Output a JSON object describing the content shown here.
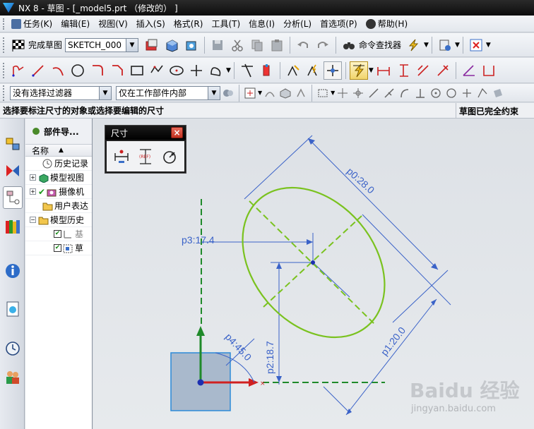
{
  "window": {
    "title": "NX 8 - 草图 - [_model5.prt （修改的） ]"
  },
  "menu": {
    "items": [
      "任务(K)",
      "编辑(E)",
      "视图(V)",
      "插入(S)",
      "格式(R)",
      "工具(T)",
      "信息(I)",
      "分析(L)",
      "首选项(P)",
      "帮助(H)"
    ]
  },
  "toolbar": {
    "finish_sketch": "完成草图",
    "sketch_name": "SKETCH_000",
    "command_finder": "命令查找器"
  },
  "filters": {
    "selection_filter": "没有选择过滤器",
    "scope": "仅在工作部件内部"
  },
  "status": {
    "prompt": "选择要标注尺寸的对象或选择要编辑的尺寸",
    "constraint_state": "草图已完全约束"
  },
  "navigator": {
    "title": "部件导...",
    "column_name": "名称",
    "rows": [
      {
        "label": "历史记录",
        "icon": "history-clock-icon"
      },
      {
        "label": "模型视图",
        "icon": "model-views-icon"
      },
      {
        "label": "摄像机",
        "icon": "camera-icon"
      },
      {
        "label": "用户表达",
        "icon": "folder-icon"
      },
      {
        "label": "模型历史",
        "icon": "folder-icon"
      },
      {
        "label": "基",
        "icon": "datum-icon"
      },
      {
        "label": "草",
        "icon": "sketch-icon"
      }
    ]
  },
  "dimension_dialog": {
    "title": "尺寸",
    "tools": [
      "inferred-dimension-icon",
      "reference-dimension-icon",
      "radius-dimension-icon"
    ],
    "ref_label": "(REF)"
  },
  "sketch": {
    "dimensions": {
      "p0": "p0:28.0",
      "p1": "p1:20.0",
      "p2": "p2:18.7",
      "p3": "p3:17.4",
      "p4": "p4:45.0"
    },
    "colors": {
      "ellipse": "#7ac21f",
      "dimension": "#3a62c8",
      "axis_green": "#1f8a2a",
      "axis_red": "#d02020",
      "datum_box": "#a9b9cc"
    }
  },
  "watermark": {
    "brand": "Baidu 经验",
    "site": "jingyan.baidu.com"
  }
}
